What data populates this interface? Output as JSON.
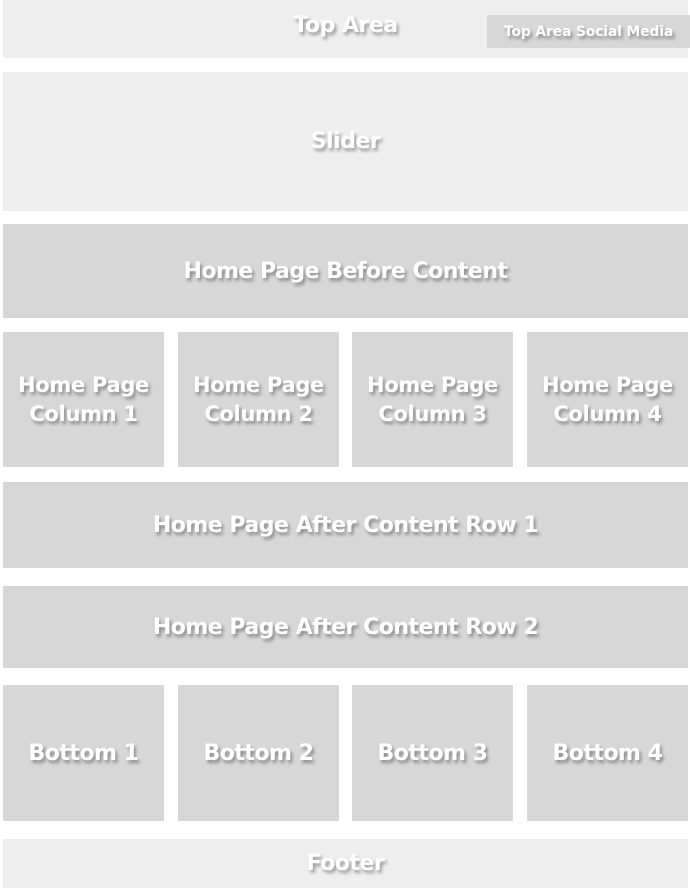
{
  "layout_diagram": {
    "top_area": {
      "label": "Top Area",
      "social_media": "Top Area Social Media"
    },
    "slider": {
      "label": "Slider"
    },
    "before_content": {
      "label": "Home Page Before Content"
    },
    "columns": [
      {
        "line1": "Home Page",
        "line2": "Column 1"
      },
      {
        "line1": "Home Page",
        "line2": "Column 2"
      },
      {
        "line1": "Home Page",
        "line2": "Column 3"
      },
      {
        "line1": "Home Page",
        "line2": "Column 4"
      }
    ],
    "after_content_rows": [
      {
        "label": "Home Page After Content Row 1"
      },
      {
        "label": "Home Page After Content Row 2"
      }
    ],
    "bottom": [
      {
        "label": "Bottom 1"
      },
      {
        "label": "Bottom 2"
      },
      {
        "label": "Bottom 3"
      },
      {
        "label": "Bottom 4"
      }
    ],
    "footer": {
      "label": "Footer"
    }
  },
  "colors": {
    "light_block": "#eeeeee",
    "mid_block": "#d7d7d7",
    "text": "#ffffff",
    "background": "#ffffff"
  }
}
